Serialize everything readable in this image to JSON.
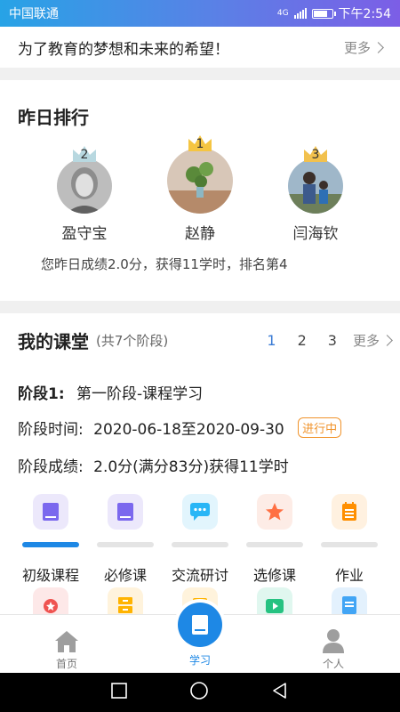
{
  "status_bar": {
    "carrier": "中国联通",
    "network": "4G",
    "time": "下午2:54"
  },
  "banner": {
    "text": "为了教育的梦想和未来的希望！",
    "more": "更多"
  },
  "ranking": {
    "title": "昨日排行",
    "people": [
      {
        "rank": "2",
        "name": "盈守宝"
      },
      {
        "rank": "1",
        "name": "赵静"
      },
      {
        "rank": "3",
        "name": "闫海钦"
      }
    ],
    "summary": "您昨日成绩2.0分，获得11学时，排名第4"
  },
  "classroom": {
    "title": "我的课堂",
    "subtitle": "(共7个阶段)",
    "pages": [
      "1",
      "2",
      "3"
    ],
    "more": "更多",
    "stage_label": "阶段1:",
    "stage_name": "第一阶段-课程学习",
    "time_label": "阶段时间:",
    "time_value": "2020-06-18至2020-09-30",
    "status_badge": "进行中",
    "score_label": "阶段成绩:",
    "score_value": "2.0分(满分83分)获得11学时"
  },
  "tiles": [
    {
      "label": "初级课程",
      "icon": "book-icon",
      "color": "#7b68ee",
      "active": true
    },
    {
      "label": "必修课",
      "icon": "book-icon",
      "color": "#7b68ee",
      "active": false
    },
    {
      "label": "交流研讨",
      "icon": "chat-icon",
      "color": "#29b6f6",
      "active": false
    },
    {
      "label": "选修课",
      "icon": "star-icon",
      "color": "#ff7043",
      "active": false
    },
    {
      "label": "作业",
      "icon": "notepad-icon",
      "color": "#ff8f00",
      "active": false
    }
  ],
  "bottom_nav": [
    {
      "label": "首页",
      "icon": "home-icon"
    },
    {
      "label": "学习",
      "icon": "book-icon",
      "active": true
    },
    {
      "label": "个人",
      "icon": "person-icon"
    }
  ],
  "colors": {
    "accent": "#1e88e5",
    "badge": "#f0932b",
    "gold_crown": "#f5c542",
    "silver_crown": "#b8d8e0",
    "bronze_crown": "#f2c14e"
  }
}
